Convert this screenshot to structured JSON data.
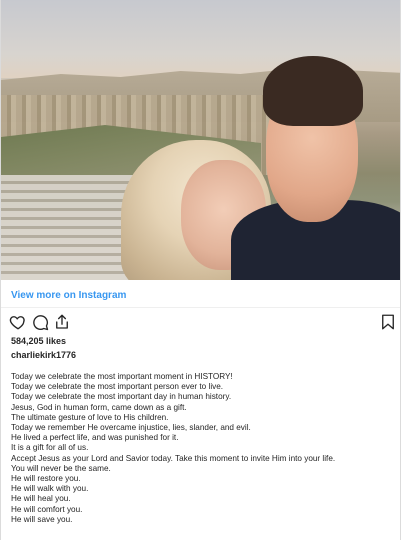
{
  "post": {
    "view_more_label": "View more on Instagram",
    "likes": "584,205 likes",
    "username": "charliekirk1776",
    "caption_lines": [
      "Today we celebrate the most important moment in HISTORY!",
      "Today we celebrate the most important person ever to live.",
      "Today we celebrate the most important day in human history.",
      "Jesus, God in human form, came down as a gift.",
      "The ultimate gesture of love to His children.",
      "Today we remember He overcame injustice, lies, slander, and evil.",
      "He lived a perfect life, and was punished for it.",
      "It is a gift for all of us.",
      "Accept Jesus as your Lord and Savior today. Take this moment to invite Him into your life.",
      "You will never be the same.",
      "He will restore you.",
      "He will walk with you.",
      "He will heal you.",
      "He will comfort you.",
      "He will save you."
    ]
  },
  "icons": {
    "like": "heart-icon",
    "comment": "comment-icon",
    "share": "share-icon",
    "save": "bookmark-icon"
  },
  "colors": {
    "link": "#3897f0",
    "text": "#262626",
    "divider": "#efefef"
  }
}
